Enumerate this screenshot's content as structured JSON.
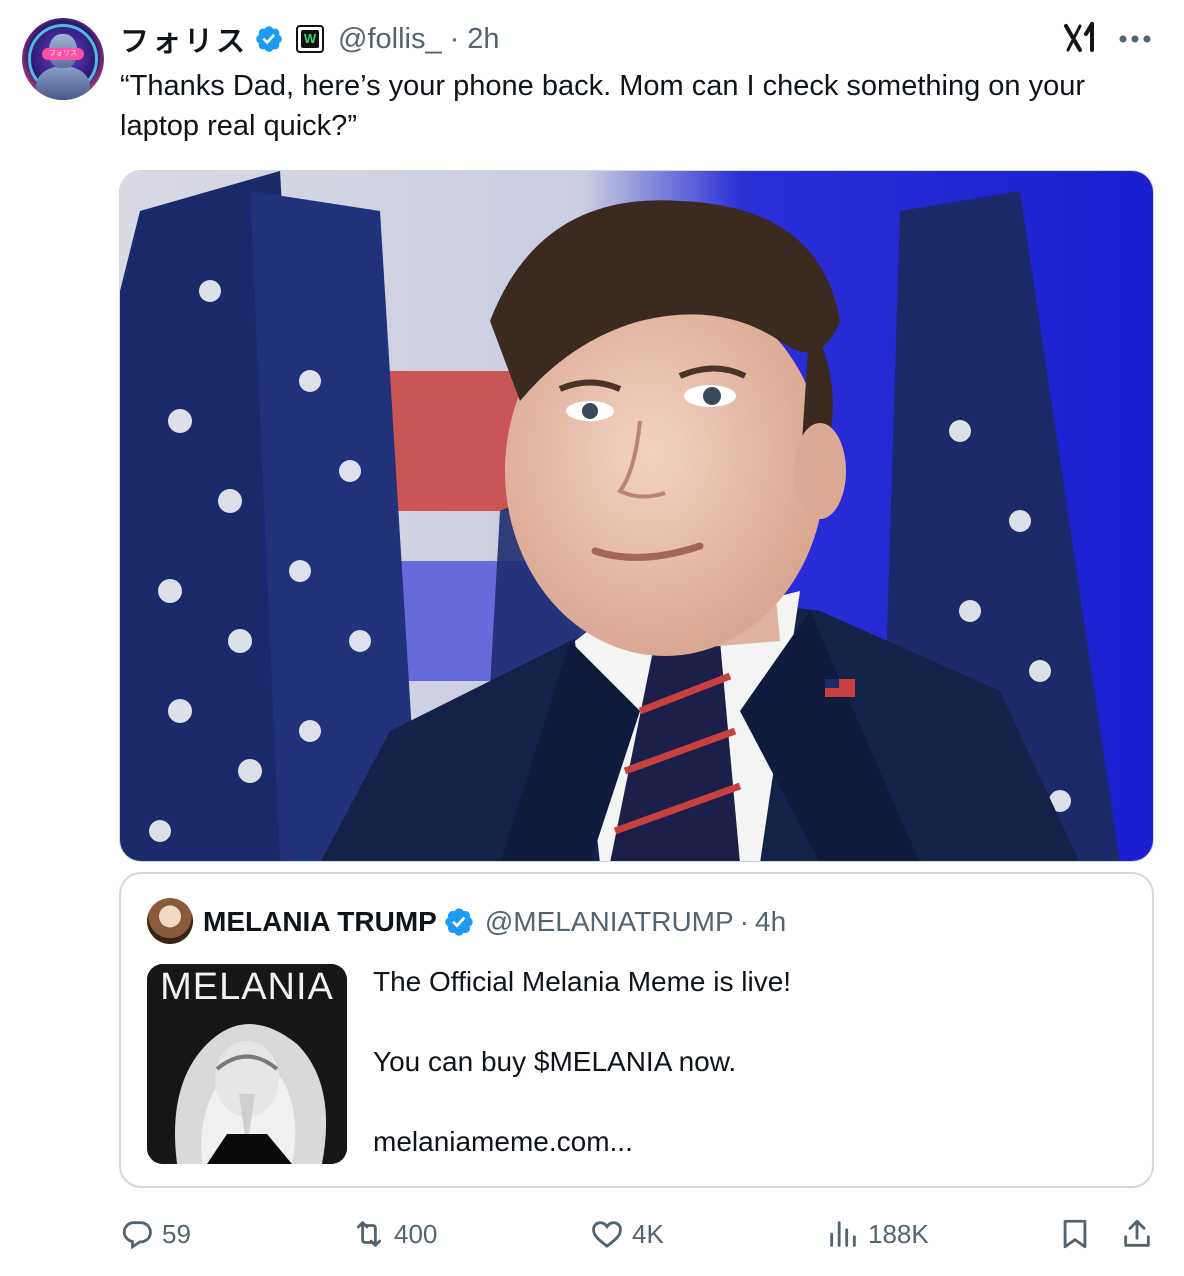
{
  "tweet": {
    "author": {
      "display_name": "フォリス",
      "handle": "@follis_",
      "time": "2h",
      "dot": "·",
      "avatar_label": "フォリス",
      "affiliation_badge": "W"
    },
    "text": "“Thanks Dad, here’s your phone back. Mom can I check something on your laptop real quick?”",
    "icons": {
      "verified": "verified-badge-icon",
      "grok": "grok-icon",
      "more": "more-icon"
    }
  },
  "quote": {
    "author": {
      "display_name": "MELANIA TRUMP",
      "handle": "@MELANIATRUMP",
      "dot": "·",
      "time": "4h"
    },
    "thumbnail_title": "MELANIA",
    "lines": [
      "The Official Melania Meme is live!",
      "You can buy $MELANIA now.",
      "melaniameme.com..."
    ]
  },
  "actions": {
    "replies": "59",
    "reposts": "400",
    "likes": "4K",
    "views": "188K"
  },
  "colors": {
    "text": "#0f1419",
    "secondary": "#536471",
    "border": "#cfd9de",
    "verified": "#1d9bf0"
  }
}
